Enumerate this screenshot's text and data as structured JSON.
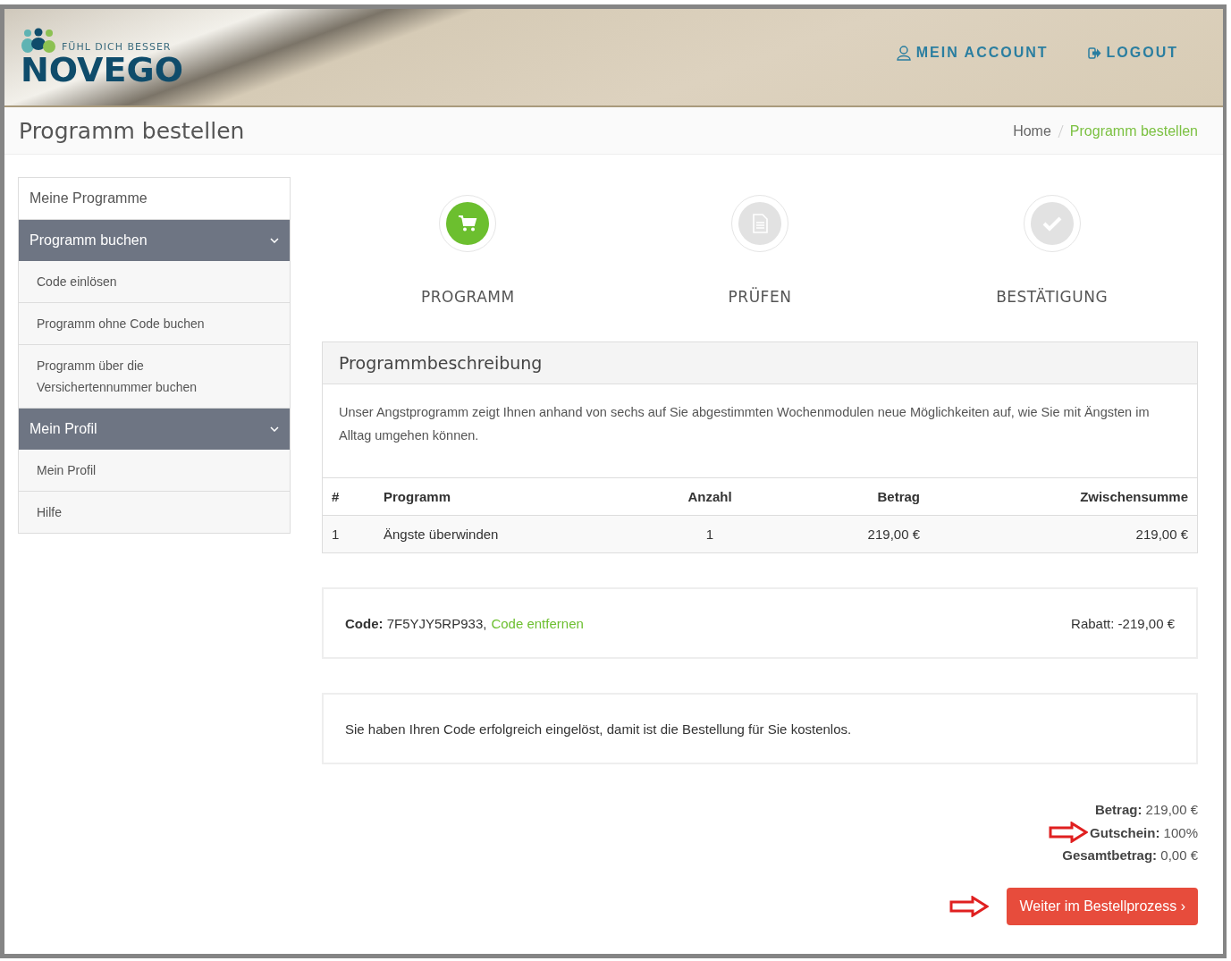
{
  "header": {
    "logo": {
      "tagline": "FÜHL DICH BESSER",
      "name": "NOVEGO"
    },
    "nav": [
      {
        "kind": "account",
        "label": "MEIN ACCOUNT"
      },
      {
        "kind": "logout",
        "label": "LOGOUT"
      }
    ]
  },
  "page_title": "Programm bestellen",
  "breadcrumb": [
    {
      "label": "Home",
      "selected": false
    },
    {
      "label": "Programm bestellen",
      "selected": true
    }
  ],
  "sidebar": {
    "items": [
      {
        "kind": "link",
        "label": "Meine Programme"
      },
      {
        "kind": "group",
        "label": "Programm buchen",
        "expanded": true,
        "children": [
          {
            "label": "Code einlösen"
          },
          {
            "label": "Programm ohne Code buchen"
          },
          {
            "label": "Programm über die Versichertennummer buchen"
          }
        ]
      },
      {
        "kind": "group",
        "label": "Mein Profil",
        "expanded": true,
        "children": [
          {
            "label": "Mein Profil"
          },
          {
            "label": "Hilfe"
          }
        ]
      }
    ]
  },
  "steps": [
    {
      "kind": "cart",
      "label": "PROGRAMM",
      "selected": true
    },
    {
      "kind": "document",
      "label": "PRÜFEN",
      "selected": false
    },
    {
      "kind": "check",
      "label": "BESTÄTIGUNG",
      "selected": false
    }
  ],
  "panel": {
    "title": "Programmbeschreibung",
    "description": "Unser Angstprogramm zeigt Ihnen anhand von sechs auf Sie abgestimmten Wochenmodulen neue Möglichkeiten auf, wie Sie mit Ängsten im Alltag umgehen können.",
    "table": {
      "columns": [
        "#",
        "Programm",
        "Anzahl",
        "Betrag",
        "Zwischensumme"
      ],
      "rows": [
        [
          "1",
          "Ängste überwinden",
          "1",
          "219,00 €",
          "219,00 €"
        ]
      ]
    }
  },
  "code_box": {
    "code": "**Code:** 7F5YJY5RP933,",
    "remove_link": "Code entfernen",
    "discount": "Rabatt: -219,00 €"
  },
  "message": "Sie haben Ihren Code erfolgreich eingelöst, damit ist die Bestellung für Sie kostenlos.",
  "totals": [
    {
      "text": "**Betrag:** 219,00 €",
      "marked": false
    },
    {
      "text": "**Gutschein:** 100%",
      "marked": true
    },
    {
      "text": "**Gesamtbetrag:** 0,00 €",
      "marked": false
    }
  ],
  "button": {
    "label": "Weiter im Bestellprozess ›",
    "marked": true
  }
}
